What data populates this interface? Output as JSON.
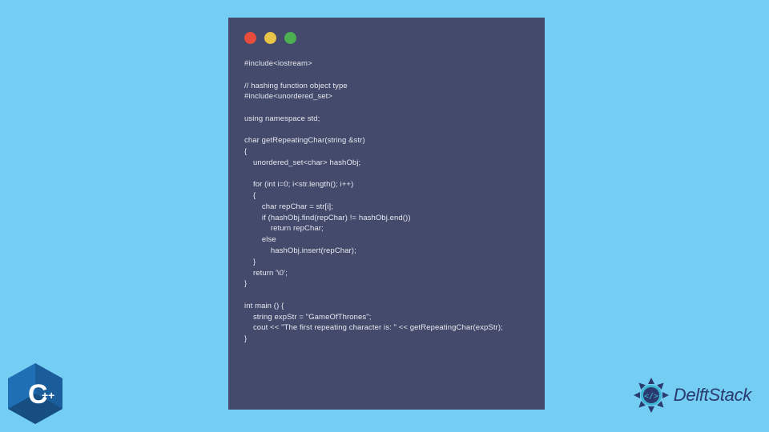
{
  "window": {
    "dots": [
      "red",
      "yellow",
      "green"
    ]
  },
  "code": {
    "lines": [
      "#include<iostream>",
      "",
      "// hashing function object type",
      "#include<unordered_set>",
      "",
      "using namespace std;",
      "",
      "char getRepeatingChar(string &str)",
      "{",
      "    unordered_set<char> hashObj;",
      "",
      "    for (int i=0; i<str.length(); i++)",
      "    {",
      "        char repChar = str[i];",
      "        if (hashObj.find(repChar) != hashObj.end())",
      "            return repChar;",
      "        else",
      "            hashObj.insert(repChar);",
      "    }",
      "    return '\\0';",
      "}",
      "",
      "int main () {",
      "    string expStr = \"GameOfThrones\";",
      "    cout << \"The first repeating character is: \" << getRepeatingChar(expStr);",
      "}"
    ]
  },
  "logos": {
    "cpp_label": "C",
    "cpp_plus": "++",
    "delft_text": "DelftStack"
  },
  "colors": {
    "background": "#74cdf2",
    "window_bg": "#434a6b",
    "code_text": "#e8e9f0",
    "dot_red": "#e74c3c",
    "dot_yellow": "#e8c547",
    "dot_green": "#4caf50",
    "cpp_blue": "#1f6fb5",
    "delft_blue": "#2a3a6e"
  }
}
